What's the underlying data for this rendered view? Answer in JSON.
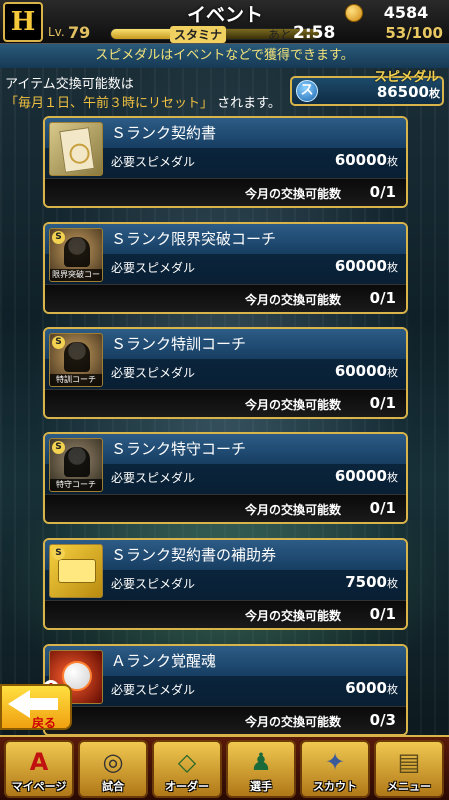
{
  "header": {
    "title": "イベント",
    "level_label": "Lv.",
    "level": "79",
    "stamina_label": "スタミナ",
    "stamina_fill": 0.53,
    "remaining_label": "あと",
    "timer": "2:58",
    "coins": "4584",
    "stamina": "53/100"
  },
  "notice": "スピメダルはイベントなどで獲得できます。",
  "info": {
    "line1": "アイテム交換可能数は",
    "line2_highlight": "「毎月１日、午前３時にリセット」",
    "line2_rest": "されます。"
  },
  "medal": {
    "title": "スピメダル",
    "icon": "ス",
    "amount": "86500",
    "unit": "枚"
  },
  "items": [
    {
      "title": "Ｓランク契約書",
      "req_label": "必要スピメダル",
      "cost": "60000",
      "unit": "枚",
      "limit_label": "今月の交換可能数",
      "limit": "0/1",
      "thumb_caption": ""
    },
    {
      "title": "Ｓランク限界突破コーチ",
      "req_label": "必要スピメダル",
      "cost": "60000",
      "unit": "枚",
      "limit_label": "今月の交換可能数",
      "limit": "0/1",
      "thumb_caption": "限界突破コーチ"
    },
    {
      "title": "Ｓランク特訓コーチ",
      "req_label": "必要スピメダル",
      "cost": "60000",
      "unit": "枚",
      "limit_label": "今月の交換可能数",
      "limit": "0/1",
      "thumb_caption": "特訓コーチ"
    },
    {
      "title": "Ｓランク特守コーチ",
      "req_label": "必要スピメダル",
      "cost": "60000",
      "unit": "枚",
      "limit_label": "今月の交換可能数",
      "limit": "0/1",
      "thumb_caption": "特守コーチ"
    },
    {
      "title": "Ｓランク契約書の補助券",
      "req_label": "必要スピメダル",
      "cost": "7500",
      "unit": "枚",
      "limit_label": "今月の交換可能数",
      "limit": "0/1",
      "thumb_caption": ""
    },
    {
      "title": "Ａランク覚醒魂",
      "req_label": "必要スピメダル",
      "cost": "6000",
      "unit": "枚",
      "limit_label": "今月の交換可能数",
      "limit": "0/3",
      "thumb_caption": ""
    }
  ],
  "back_button": "戻る",
  "nav": [
    {
      "label": "マイページ",
      "icon": "A"
    },
    {
      "label": "試合",
      "icon": "◎"
    },
    {
      "label": "オーダー",
      "icon": "◇"
    },
    {
      "label": "選手",
      "icon": "♟"
    },
    {
      "label": "スカウト",
      "icon": "✦"
    },
    {
      "label": "メニュー",
      "icon": "▤"
    }
  ]
}
